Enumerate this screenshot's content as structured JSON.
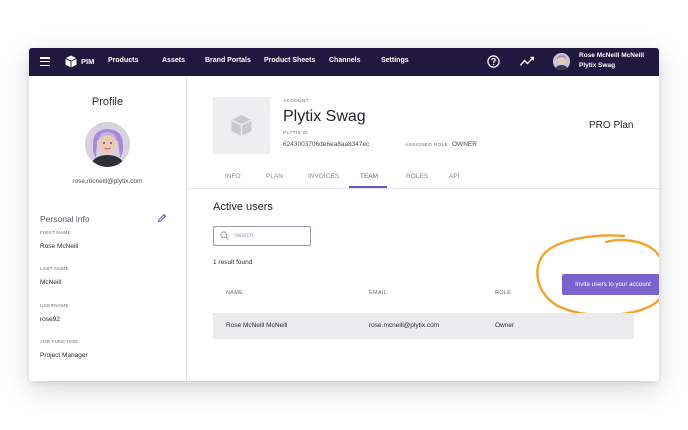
{
  "topbar": {
    "brand": "PIM",
    "nav": [
      "Products",
      "Assets",
      "Brand Portals",
      "Product Sheets",
      "Channels",
      "Settings"
    ],
    "user_name": "Rose McNeill McNeill",
    "user_org": "Plytix Swag",
    "icons": [
      "menu-icon",
      "cube-icon",
      "help-icon",
      "activity-icon"
    ]
  },
  "sidebar": {
    "title": "Profile",
    "email": "rose.mcneill@plytix.com",
    "section_title": "Personal info",
    "fields": [
      {
        "label": "FIRST NAME",
        "value": "Rose McNeill"
      },
      {
        "label": "LAST NAME",
        "value": "McNeill"
      },
      {
        "label": "USERNAME",
        "value": "rose92"
      },
      {
        "label": "JOB FUNCTION",
        "value": "Project Manager"
      }
    ]
  },
  "account": {
    "label": "ACCOUNT",
    "name": "Plytix Swag",
    "id_label": "PLYTIX ID",
    "id": "6243003706de6ea8aa8347ec",
    "role_label": "ASSIGNED ROLE",
    "role": "OWNER",
    "plan": "PRO Plan"
  },
  "tabs": [
    "INFO",
    "PLAN",
    "INVOICES",
    "TEAM",
    "ROLES",
    "API"
  ],
  "active_tab": "TEAM",
  "team": {
    "heading": "Active users",
    "search_placeholder": "Search",
    "invite_label": "Invite users to your account",
    "result_count": "1 result found",
    "columns": [
      "NAME",
      "EMAIL",
      "ROLE"
    ],
    "rows": [
      {
        "name": "Rose McNeill McNeill",
        "email": "rose.mcneill@plytix.com",
        "role": "Owner"
      }
    ]
  },
  "colors": {
    "topbar": "#21183f",
    "accent": "#7a63cc",
    "highlight": "#f2a22a",
    "row_bg": "#ebebed"
  }
}
